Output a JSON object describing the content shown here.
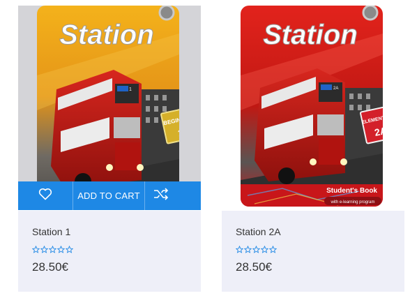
{
  "colors": {
    "accent": "#1e88e5",
    "card_info_bg": "#eeeff8",
    "star": "#1e88e5"
  },
  "products": [
    {
      "name": "Station 1",
      "price": "28.50€",
      "rating_stars": 0,
      "cover": {
        "title": "Station",
        "level": "BEGINNER",
        "number": "1"
      },
      "actions": {
        "wishlist_icon": "heart-outline-icon",
        "add_to_cart_label": "ADD TO CART",
        "compare_icon": "shuffle-icon"
      }
    },
    {
      "name": "Station 2A",
      "price": "28.50€",
      "rating_stars": 0,
      "cover": {
        "title": "Station",
        "level": "ELEMENTARY",
        "number": "2A",
        "subtitle": "Student's Book",
        "tagline": "with e-learning program"
      }
    }
  ]
}
